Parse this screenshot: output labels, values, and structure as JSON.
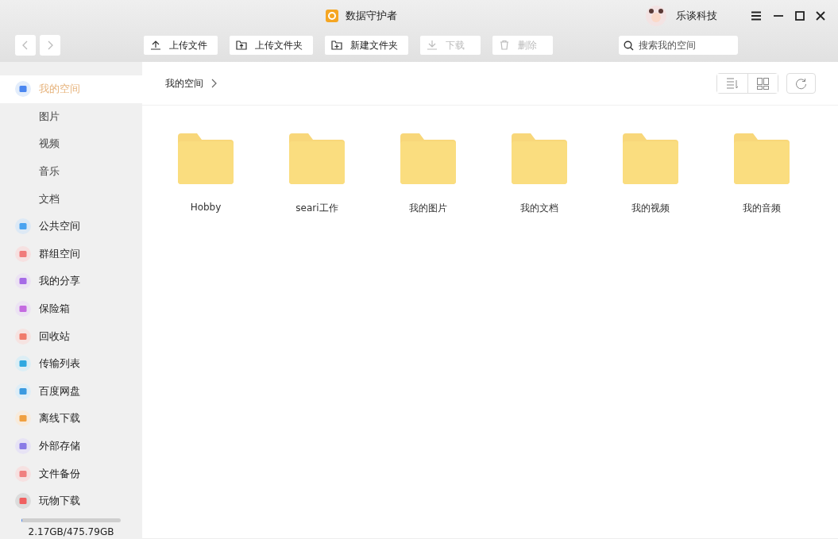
{
  "window": {
    "title": "数据守护者",
    "user": "乐谈科技"
  },
  "toolbar": {
    "buttons": [
      {
        "label": "上传文件",
        "disabled": false
      },
      {
        "label": "上传文件夹",
        "disabled": false
      },
      {
        "label": "新建文件夹",
        "disabled": false
      },
      {
        "label": "下载",
        "disabled": true
      },
      {
        "label": "删除",
        "disabled": true
      }
    ],
    "search": {
      "placeholder": "搜索我的空间"
    }
  },
  "sidebar": {
    "items": [
      {
        "label": "我的空间",
        "kind": "main",
        "selected": true
      },
      {
        "label": "图片",
        "kind": "sub",
        "selected": false
      },
      {
        "label": "视频",
        "kind": "sub",
        "selected": false
      },
      {
        "label": "音乐",
        "kind": "sub",
        "selected": false
      },
      {
        "label": "文档",
        "kind": "sub",
        "selected": false
      },
      {
        "label": "公共空间",
        "kind": "main",
        "selected": false
      },
      {
        "label": "群组空间",
        "kind": "main",
        "selected": false
      },
      {
        "label": "我的分享",
        "kind": "main",
        "selected": false
      },
      {
        "label": "保险箱",
        "kind": "main",
        "selected": false
      },
      {
        "label": "回收站",
        "kind": "main",
        "selected": false
      },
      {
        "label": "传输列表",
        "kind": "main",
        "selected": false
      },
      {
        "label": "百度网盘",
        "kind": "main",
        "selected": false
      },
      {
        "label": "离线下载",
        "kind": "main",
        "selected": false
      },
      {
        "label": "外部存储",
        "kind": "main",
        "selected": false
      },
      {
        "label": "文件备份",
        "kind": "main",
        "selected": false
      },
      {
        "label": "玩物下载",
        "kind": "main",
        "selected": false
      }
    ],
    "storage": {
      "level": 0.005,
      "reading": "2.17GB/475.79GB"
    }
  },
  "breadcrumb": [
    "我的空间"
  ],
  "folders": [
    {
      "name": "Hobby"
    },
    {
      "name": "seari工作"
    },
    {
      "name": "我的图片"
    },
    {
      "name": "我的文档"
    },
    {
      "name": "我的视频"
    },
    {
      "name": "我的音频"
    }
  ]
}
